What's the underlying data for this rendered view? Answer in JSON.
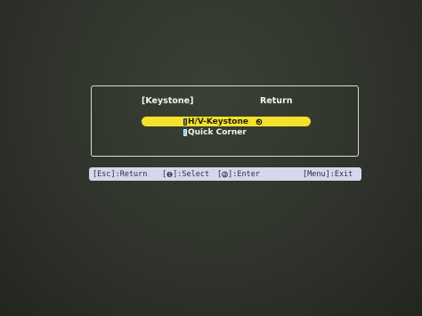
{
  "menu": {
    "title": "[Keystone]",
    "return_label": "Return",
    "options": [
      {
        "label": "H/V-Keystone",
        "selected": true
      },
      {
        "label": "Quick Corner",
        "selected": false
      }
    ]
  },
  "help_bar": {
    "esc": "[Esc]:Return",
    "select_open": "[",
    "select_close": "]:Select",
    "enter_open": "[",
    "enter_close": "]:Enter",
    "menu_exit": "[Menu]:Exit",
    "select_icon": "up-down-arrow-icon",
    "enter_icon": "enter-icon"
  },
  "colors": {
    "background": "#2f332b",
    "highlight": "#f3e12c",
    "help_bar": "#d5d8ec",
    "unselected_radio": "#6fd3ff"
  }
}
